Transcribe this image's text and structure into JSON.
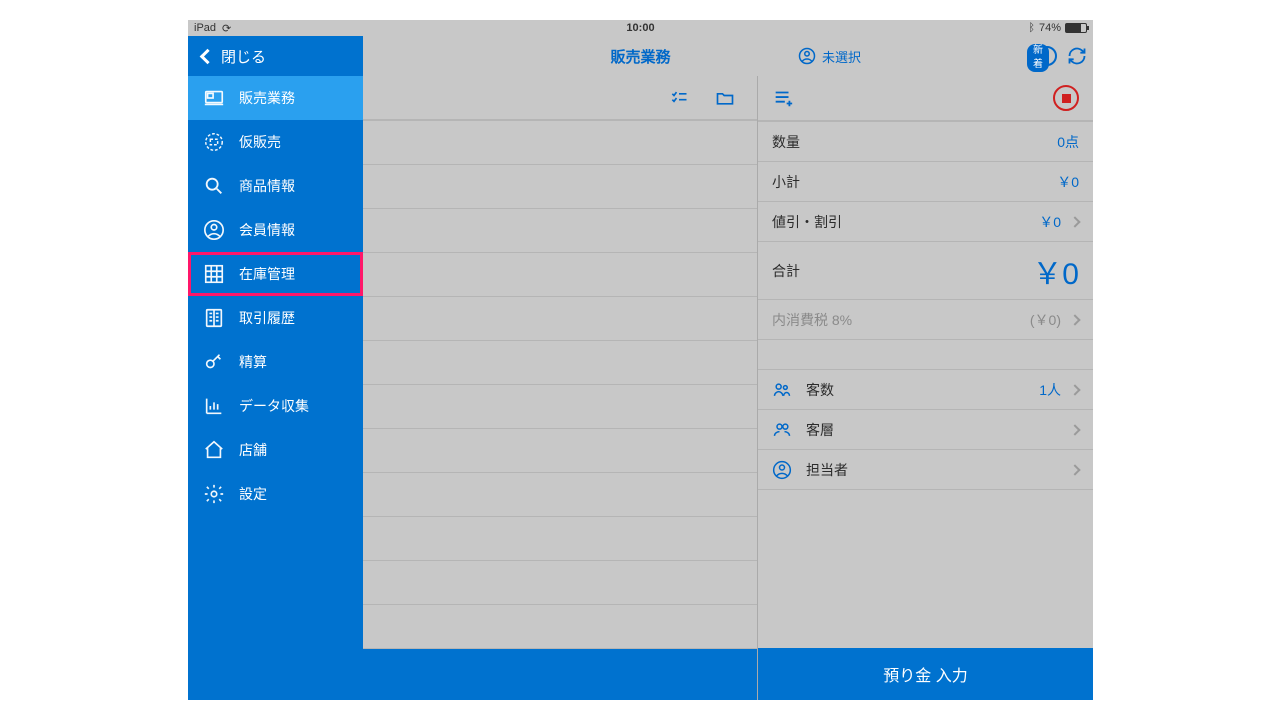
{
  "statusbar": {
    "device": "iPad",
    "time": "10:00",
    "battery": "74%"
  },
  "topbar": {
    "back_label": "閉じる",
    "title": "販売業務",
    "member_label": "未選択",
    "badge": "新着"
  },
  "sidebar": {
    "items": [
      {
        "label": "販売業務",
        "icon": "register"
      },
      {
        "label": "仮販売",
        "icon": "register-dashed"
      },
      {
        "label": "商品情報",
        "icon": "search"
      },
      {
        "label": "会員情報",
        "icon": "person"
      },
      {
        "label": "在庫管理",
        "icon": "grid"
      },
      {
        "label": "取引履歴",
        "icon": "book"
      },
      {
        "label": "精算",
        "icon": "key"
      },
      {
        "label": "データ収集",
        "icon": "chart"
      },
      {
        "label": "店舗",
        "icon": "home"
      },
      {
        "label": "設定",
        "icon": "gear"
      }
    ]
  },
  "summary": {
    "qty_label": "数量",
    "qty_value": "0点",
    "subtotal_label": "小計",
    "subtotal_value": "￥0",
    "discount_label": "値引・割引",
    "discount_value": "￥0",
    "total_label": "合計",
    "total_value": "￥0",
    "tax_label": "内消費税 8%",
    "tax_value": "(￥0)",
    "guests_label": "客数",
    "guests_value": "1人",
    "segment_label": "客層",
    "staff_label": "担当者"
  },
  "footer": {
    "deposit_label": "預り金 入力"
  }
}
